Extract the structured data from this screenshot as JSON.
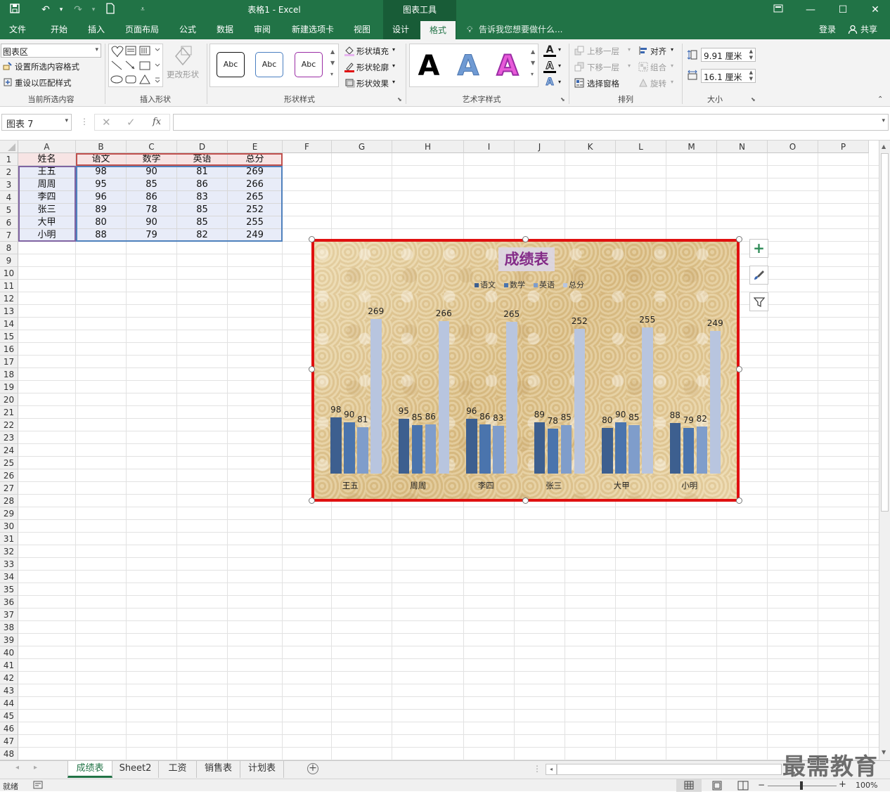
{
  "titlebar": {
    "title": "表格1 - Excel",
    "context_tab": "图表工具"
  },
  "tabs": [
    "文件",
    "开始",
    "插入",
    "页面布局",
    "公式",
    "数据",
    "审阅",
    "新建选项卡",
    "视图",
    "设计",
    "格式"
  ],
  "active_tab": "格式",
  "tell_me": "告诉我您想要做什么...",
  "login": "登录",
  "share": "共享",
  "ribbon": {
    "current_selection": {
      "dropdown": "图表区",
      "format_selection": "设置所选内容格式",
      "reset_style": "重设以匹配样式",
      "label": "当前所选内容"
    },
    "insert_shapes": {
      "change_shape": "更改形状",
      "label": "插入形状"
    },
    "shape_styles": {
      "abc": "Abc",
      "fill": "形状填充",
      "outline": "形状轮廓",
      "effects": "形状效果",
      "label": "形状样式"
    },
    "wordart": {
      "a": "A",
      "label": "艺术字样式"
    },
    "arrange": {
      "bring_forward": "上移一层",
      "send_backward": "下移一层",
      "selection_pane": "选择窗格",
      "align": "对齐",
      "group": "组合",
      "rotate": "旋转",
      "label": "排列"
    },
    "size": {
      "height": "9.91 厘米",
      "width": "16.1 厘米",
      "label": "大小"
    }
  },
  "formula_bar": {
    "name_box": "图表 7",
    "fx": "fx",
    "content": ""
  },
  "columns": [
    "A",
    "B",
    "C",
    "D",
    "E",
    "F",
    "G",
    "H",
    "I",
    "J",
    "K",
    "L",
    "M",
    "N",
    "O",
    "P"
  ],
  "rows": [
    "1",
    "2",
    "3",
    "4",
    "5",
    "6",
    "7",
    "8",
    "9",
    "10",
    "11",
    "12",
    "13",
    "14",
    "15",
    "16",
    "17",
    "18",
    "19",
    "20",
    "21",
    "22",
    "23",
    "24",
    "25",
    "26",
    "27",
    "28",
    "29",
    "30",
    "31",
    "32",
    "33",
    "34",
    "35",
    "36",
    "37",
    "38",
    "39",
    "40",
    "41",
    "42",
    "43",
    "44",
    "45",
    "46",
    "47",
    "48"
  ],
  "table": {
    "header": [
      "姓名",
      "语文",
      "数学",
      "英语",
      "总分"
    ],
    "rows": [
      [
        "王五",
        "98",
        "90",
        "81",
        "269"
      ],
      [
        "周周",
        "95",
        "85",
        "86",
        "266"
      ],
      [
        "李四",
        "96",
        "86",
        "83",
        "265"
      ],
      [
        "张三",
        "89",
        "78",
        "85",
        "252"
      ],
      [
        "大甲",
        "80",
        "90",
        "85",
        "255"
      ],
      [
        "小明",
        "88",
        "79",
        "82",
        "249"
      ]
    ]
  },
  "chart_data": {
    "type": "bar",
    "title": "成绩表",
    "categories": [
      "王五",
      "周周",
      "李四",
      "张三",
      "大甲",
      "小明"
    ],
    "series": [
      {
        "name": "语文",
        "values": [
          98,
          95,
          96,
          89,
          80,
          88
        ]
      },
      {
        "name": "数学",
        "values": [
          90,
          85,
          86,
          78,
          90,
          79
        ]
      },
      {
        "name": "英语",
        "values": [
          81,
          86,
          83,
          85,
          85,
          82
        ]
      },
      {
        "name": "总分",
        "values": [
          269,
          266,
          265,
          252,
          255,
          249
        ]
      }
    ],
    "colors": [
      "#3d5f8f",
      "#4a74ad",
      "#7f9dcb",
      "#b8c5df"
    ],
    "ylim": [
      0,
      300
    ],
    "legend": "top",
    "grid": false,
    "data_labels": true
  },
  "sheets": [
    "成绩表",
    "Sheet2",
    "工资",
    "销售表",
    "计划表"
  ],
  "active_sheet": "成绩表",
  "status": {
    "ready": "就绪",
    "zoom": "100%"
  },
  "watermark": "最需教育"
}
